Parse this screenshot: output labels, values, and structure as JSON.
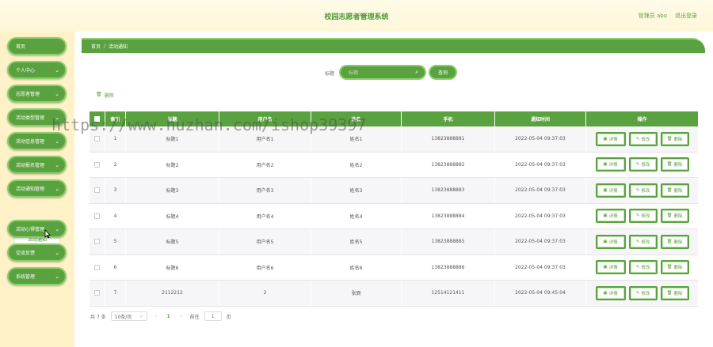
{
  "header": {
    "title": "校园志愿者管理系统",
    "user_label": "管理员 abo",
    "logout": "退出登录"
  },
  "sidebar": {
    "items": [
      {
        "label": "首页",
        "has_chevron": false
      },
      {
        "label": "个人中心",
        "has_chevron": true
      },
      {
        "label": "志愿者管理",
        "has_chevron": true
      },
      {
        "label": "活动类型管理",
        "has_chevron": true
      },
      {
        "label": "活动信息管理",
        "has_chevron": true
      },
      {
        "label": "活动报名管理",
        "has_chevron": true
      },
      {
        "label": "活动通知管理",
        "has_chevron": true
      },
      {
        "label": "活动心得管理",
        "has_chevron": true
      },
      {
        "label": "交流反馈",
        "has_chevron": true
      },
      {
        "label": "系统管理",
        "has_chevron": true
      }
    ],
    "submenu": {
      "label": "活动通知"
    }
  },
  "breadcrumb": {
    "home": "首页",
    "sep": "/",
    "current": "活动通知"
  },
  "search": {
    "label": "标题",
    "placeholder": "标题",
    "button": "查询"
  },
  "actions": {
    "delete": "删除"
  },
  "table": {
    "headers": {
      "index": "索引",
      "title": "标题",
      "user": "用户名",
      "name": "姓名",
      "phone": "手机",
      "time": "通知时间",
      "ops": "操作"
    },
    "ops": {
      "detail": "详情",
      "edit": "修改",
      "delete": "删除"
    },
    "rows": [
      {
        "index": "1",
        "title": "标题1",
        "user": "用户名1",
        "name": "姓名1",
        "phone": "13823888881",
        "time": "2022-05-04 09:37:03"
      },
      {
        "index": "2",
        "title": "标题2",
        "user": "用户名2",
        "name": "姓名2",
        "phone": "13823888882",
        "time": "2022-05-04 09:37:03"
      },
      {
        "index": "3",
        "title": "标题3",
        "user": "用户名3",
        "name": "姓名3",
        "phone": "13823888883",
        "time": "2022-05-04 09:37:03"
      },
      {
        "index": "4",
        "title": "标题4",
        "user": "用户名4",
        "name": "姓名4",
        "phone": "13823888884",
        "time": "2022-05-04 09:37:03"
      },
      {
        "index": "5",
        "title": "标题5",
        "user": "用户名5",
        "name": "姓名5",
        "phone": "13823888885",
        "time": "2022-05-04 09:37:03"
      },
      {
        "index": "6",
        "title": "标题6",
        "user": "用户名6",
        "name": "姓名6",
        "phone": "13823888886",
        "time": "2022-05-04 09:37:03"
      },
      {
        "index": "7",
        "title": "2112212",
        "user": "2",
        "name": "张弼",
        "phone": "12514121411",
        "time": "2022-05-04 09:45:04"
      }
    ]
  },
  "pagination": {
    "total": "共 7 条",
    "page_size": "10条/页",
    "current_page": "1",
    "goto_label": "前往",
    "goto_value": "1",
    "page_suffix": "页"
  },
  "watermark": "https://www.huzhan.com/ishop39397",
  "colors": {
    "accent": "#5aa23f",
    "accent_light": "#8ccf6a",
    "sidebar_bg": "#fff1c8",
    "header_bg": "#fef6d8"
  }
}
